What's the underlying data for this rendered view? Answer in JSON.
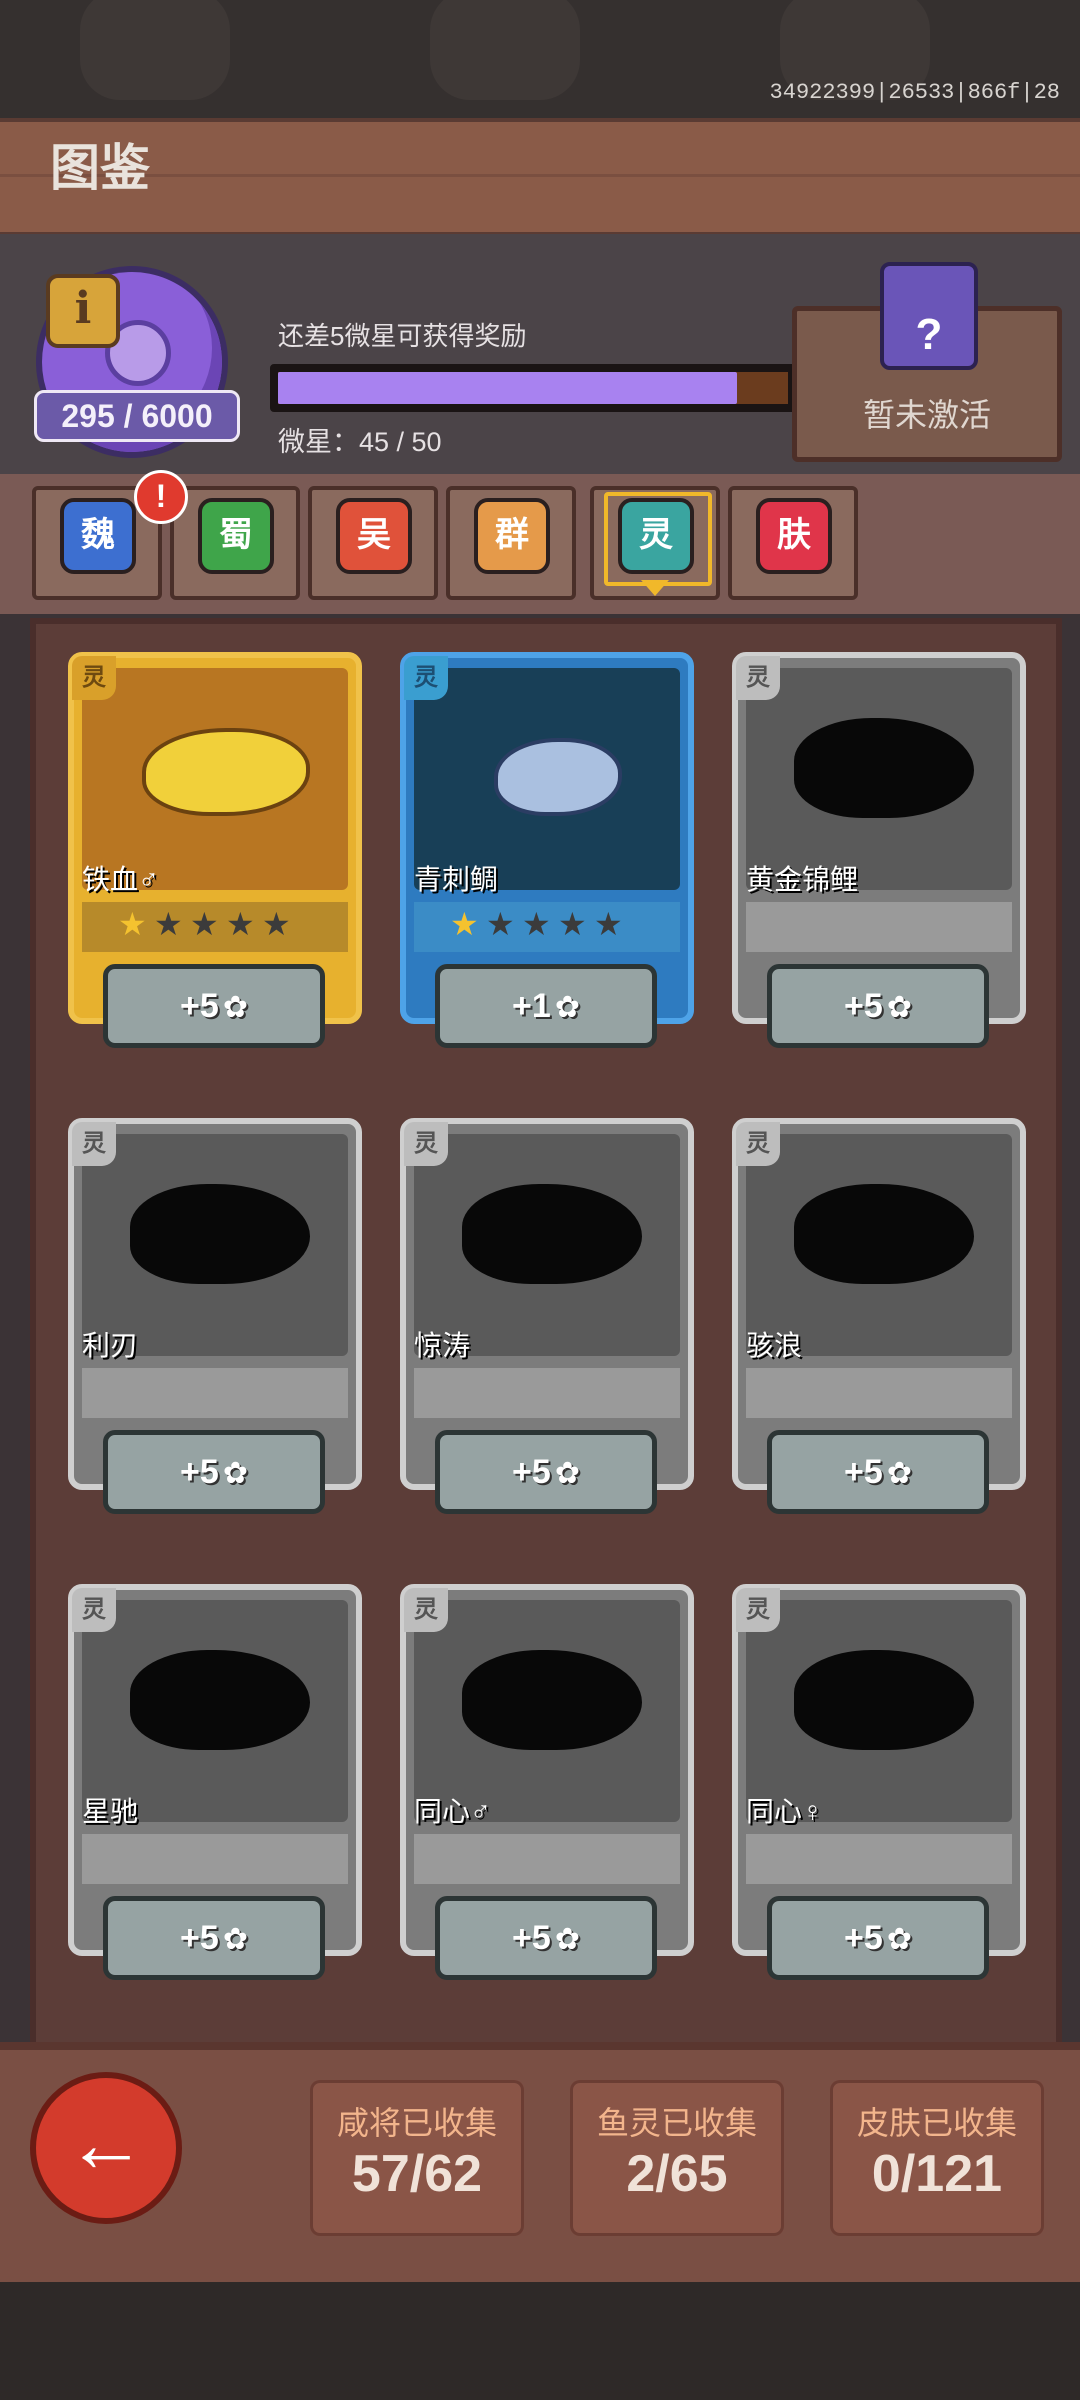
{
  "build_info": "34922399|26533|866f|28",
  "header": {
    "title": "图鉴"
  },
  "status": {
    "points": "295 / 6000",
    "info_icon": "i",
    "reward_text": "还差5微星可获得奖励",
    "progress_value": 0.9,
    "stars_text": "微星：45 / 50",
    "inactive_label": "暂未激活",
    "chest_icon": "?"
  },
  "tabs": [
    {
      "label": "魏",
      "color": "#3d6fd0",
      "alert": "!"
    },
    {
      "label": "蜀",
      "color": "#3fa54a"
    },
    {
      "label": "吴",
      "color": "#e0523a"
    },
    {
      "label": "群",
      "color": "#e59a4a"
    },
    {
      "label": "灵",
      "color": "#3aa5a0",
      "active": true
    },
    {
      "label": "肤",
      "color": "#e0354a"
    }
  ],
  "cards": [
    {
      "name": "铁血♂",
      "tag": "灵",
      "reward": "+5",
      "style": "gold",
      "stars": 1
    },
    {
      "name": "青刺鲷",
      "tag": "灵",
      "reward": "+1",
      "style": "blue",
      "stars": 1
    },
    {
      "name": "黄金锦鲤",
      "tag": "灵",
      "reward": "+5",
      "style": "locked"
    },
    {
      "name": "利刃",
      "tag": "灵",
      "reward": "+5",
      "style": "locked"
    },
    {
      "name": "惊涛",
      "tag": "灵",
      "reward": "+5",
      "style": "locked"
    },
    {
      "name": "骇浪",
      "tag": "灵",
      "reward": "+5",
      "style": "locked"
    },
    {
      "name": "星驰",
      "tag": "灵",
      "reward": "+5",
      "style": "locked"
    },
    {
      "name": "同心♂",
      "tag": "灵",
      "reward": "+5",
      "style": "locked"
    },
    {
      "name": "同心♀",
      "tag": "灵",
      "reward": "+5",
      "style": "locked"
    }
  ],
  "stats": [
    {
      "label": "咸将已收集",
      "value": "57/62"
    },
    {
      "label": "鱼灵已收集",
      "value": "2/65"
    },
    {
      "label": "皮肤已收集",
      "value": "0/121"
    }
  ],
  "back_icon": "←",
  "star_glyph": "★",
  "gear_glyph": "✿"
}
